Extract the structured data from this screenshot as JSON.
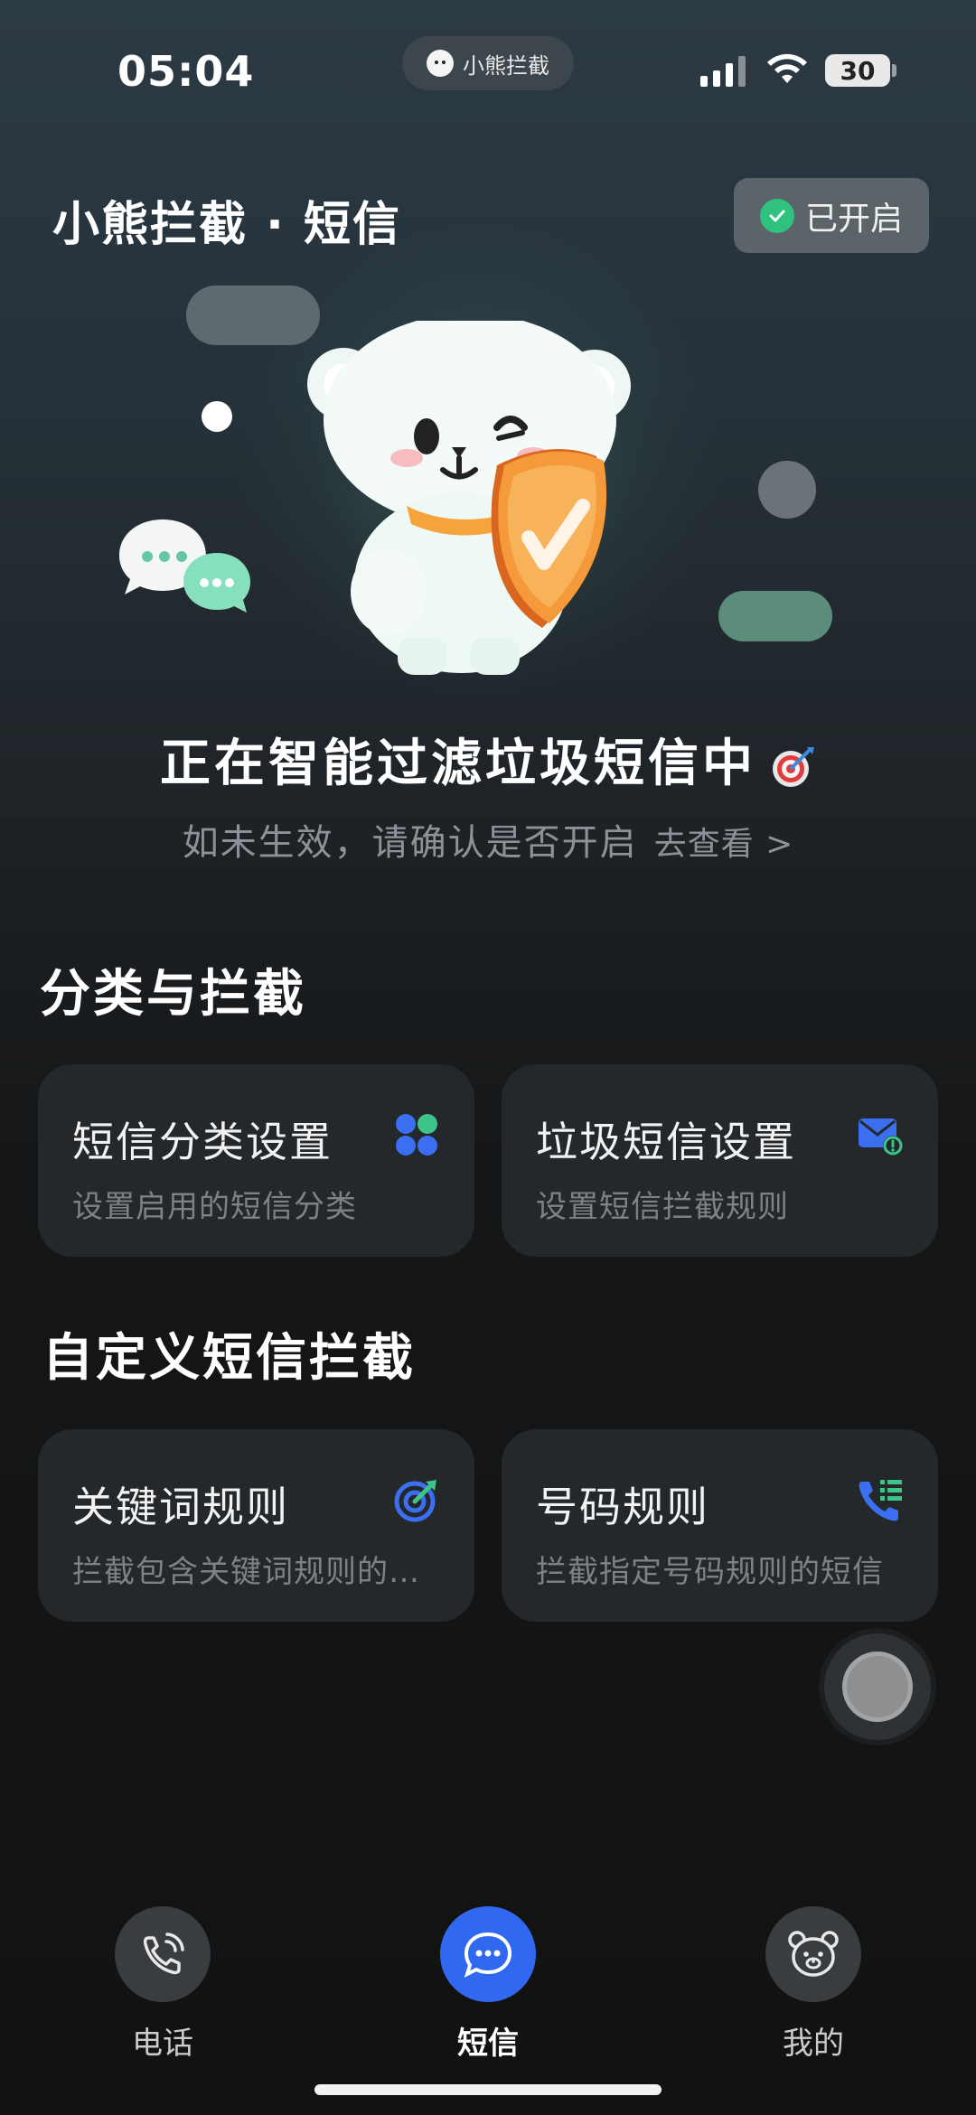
{
  "status_bar": {
    "time": "05:04",
    "pill_label": "小熊拦截",
    "battery": "30"
  },
  "header": {
    "title": "小熊拦截 · 短信",
    "status_badge": "已开启"
  },
  "hero": {
    "title": "正在智能过滤垃圾短信中",
    "subtitle": "如未生效，请确认是否开启",
    "link": "去查看 >"
  },
  "sections": {
    "classify": {
      "title": "分类与拦截",
      "cards": [
        {
          "title": "短信分类设置",
          "desc": "设置启用的短信分类",
          "icon": "grid-clover-icon"
        },
        {
          "title": "垃圾短信设置",
          "desc": "设置短信拦截规则",
          "icon": "mail-alert-icon"
        }
      ]
    },
    "custom": {
      "title": "自定义短信拦截",
      "cards": [
        {
          "title": "关键词规则",
          "desc": "拦截包含关键词规则的短信",
          "icon": "target-arrow-icon"
        },
        {
          "title": "号码规则",
          "desc": "拦截指定号码规则的短信",
          "icon": "phone-list-icon"
        }
      ]
    }
  },
  "bottom_nav": {
    "items": [
      {
        "label": "电话",
        "icon": "phone-icon",
        "active": false
      },
      {
        "label": "短信",
        "icon": "message-icon",
        "active": true
      },
      {
        "label": "我的",
        "icon": "bear-icon",
        "active": false
      }
    ]
  },
  "colors": {
    "accent_blue": "#3168f0",
    "status_green": "#2fc27f",
    "shield_orange": "#f59a3a"
  }
}
